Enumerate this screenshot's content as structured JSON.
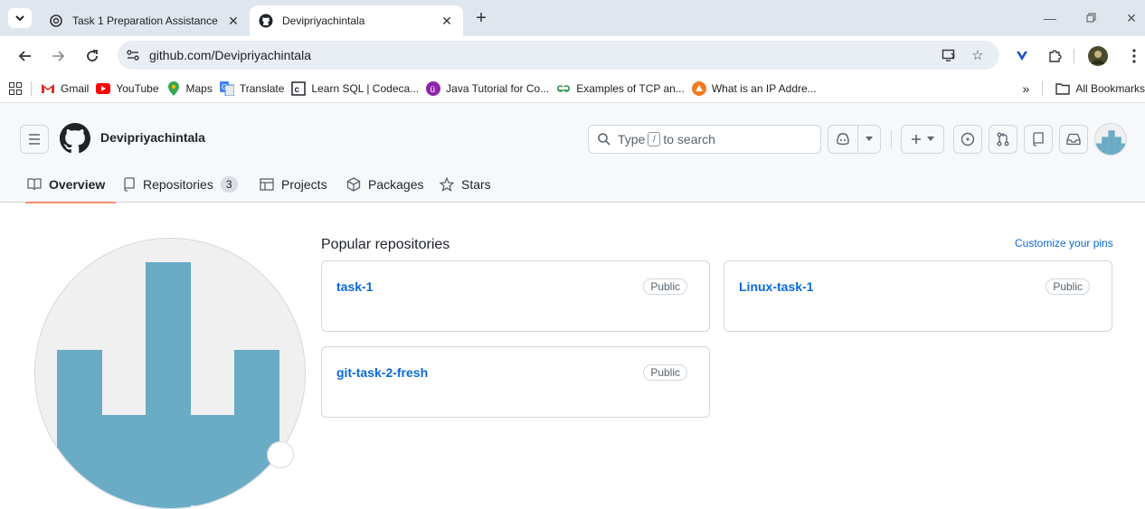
{
  "browser": {
    "tabs": [
      {
        "title": "Task 1 Preparation Assistance",
        "active": false
      },
      {
        "title": "Devipriyachintala",
        "active": true
      }
    ],
    "url": "github.com/Devipriyachintala",
    "bookmarks": [
      {
        "label": "Gmail",
        "icon": "gmail-icon"
      },
      {
        "label": "YouTube",
        "icon": "youtube-icon"
      },
      {
        "label": "Maps",
        "icon": "maps-icon"
      },
      {
        "label": "Translate",
        "icon": "translate-icon"
      },
      {
        "label": "Learn SQL | Codeca...",
        "icon": "codecademy-icon"
      },
      {
        "label": "Java Tutorial for Co...",
        "icon": "java-tutorial-icon"
      },
      {
        "label": "Examples of TCP an...",
        "icon": "geeksforgeeks-icon"
      },
      {
        "label": "What is an IP Addre...",
        "icon": "ip-site-icon"
      }
    ],
    "all_bookmarks": "All Bookmarks",
    "more": "»"
  },
  "github": {
    "username": "Devipriyachintala",
    "search": {
      "prefix": "Type",
      "key": "/",
      "suffix": "to search"
    },
    "nav": {
      "overview": "Overview",
      "repositories": "Repositories",
      "repositories_count": "3",
      "projects": "Projects",
      "packages": "Packages",
      "stars": "Stars"
    },
    "popular_title": "Popular repositories",
    "customize_pins": "Customize your pins",
    "repos": [
      {
        "name": "task-1",
        "visibility": "Public"
      },
      {
        "name": "Linux-task-1",
        "visibility": "Public"
      },
      {
        "name": "git-task-2-fresh",
        "visibility": "Public"
      }
    ],
    "colors": {
      "link": "#0969da",
      "nav_underline": "#fd8c73",
      "identicon": "#6aabc6"
    }
  }
}
